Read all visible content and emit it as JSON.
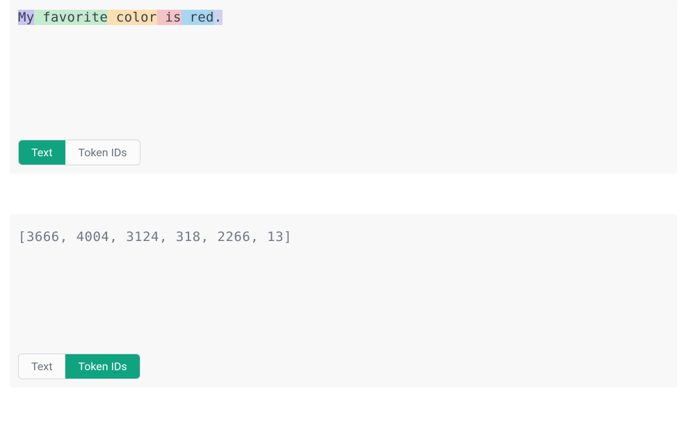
{
  "panel1": {
    "tokens": [
      {
        "text": "My",
        "bg": "#c9c2f2"
      },
      {
        "text": " favorite",
        "bg": "#c3eccd"
      },
      {
        "text": " color",
        "bg": "#fbdfb1"
      },
      {
        "text": " is",
        "bg": "#f6c2c6"
      },
      {
        "text": " red",
        "bg": "#a8d6f0"
      },
      {
        "text": ".",
        "bg": "#d0d2f0"
      }
    ],
    "toggle": {
      "text_label": "Text",
      "ids_label": "Token IDs",
      "active": "text"
    }
  },
  "panel2": {
    "ids_string": "[3666, 4004, 3124, 318, 2266, 13]",
    "toggle": {
      "text_label": "Text",
      "ids_label": "Token IDs",
      "active": "ids"
    }
  }
}
